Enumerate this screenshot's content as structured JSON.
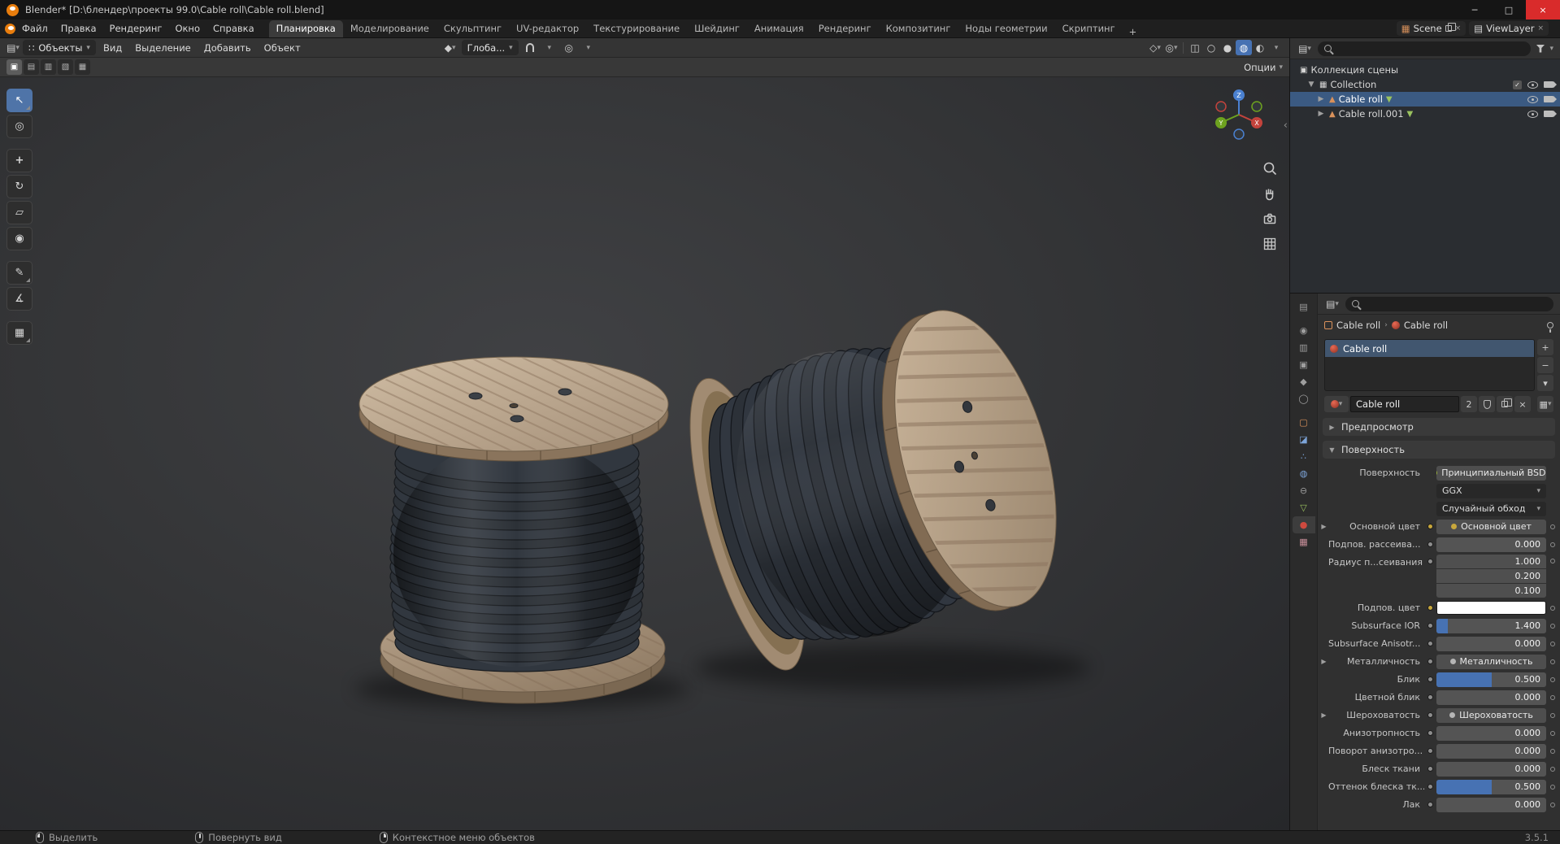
{
  "window": {
    "title": "Blender* [D:\\блендер\\проекты 99.0\\Cable roll\\Cable roll.blend]",
    "controls": {
      "minimize": "─",
      "maximize": "□",
      "close": "×"
    }
  },
  "topbar": {
    "menus": [
      "Файл",
      "Правка",
      "Рендеринг",
      "Окно",
      "Справка"
    ],
    "workspaces": [
      "Планировка",
      "Моделирование",
      "Скульптинг",
      "UV-редактор",
      "Текстурирование",
      "Шейдинг",
      "Анимация",
      "Рендеринг",
      "Композитинг",
      "Ноды геометрии",
      "Скриптинг"
    ],
    "active_workspace": "Планировка",
    "add_tab": "+",
    "scene": "Scene",
    "viewlayer": "ViewLayer"
  },
  "viewport": {
    "mode": "Объекты",
    "menus": [
      "Вид",
      "Выделение",
      "Добавить",
      "Объект"
    ],
    "orientation": "Глоба...",
    "tool_options": "Опции",
    "active_shading": "material-preview"
  },
  "outliner": {
    "rows": [
      {
        "label": "Коллекция сцены"
      },
      {
        "label": "Collection"
      },
      {
        "label": "Cable roll",
        "selected": true
      },
      {
        "label": "Cable roll.001"
      }
    ]
  },
  "properties": {
    "breadcrumb": {
      "object": "Cable roll",
      "separator": "›",
      "material": "Cable roll"
    },
    "slot": "Cable roll",
    "slot_buttons": {
      "add": "+",
      "remove": "−",
      "specials": "▾"
    },
    "datablock": {
      "name": "Cable roll",
      "users": "2"
    },
    "panels": {
      "preview": "Предпросмотр",
      "surface": "Поверхность"
    },
    "fields": [
      {
        "label": "Поверхность",
        "value": "Принципиальный BSDF"
      },
      {
        "label": "",
        "value": "GGX"
      },
      {
        "label": "",
        "value": "Случайный обход"
      },
      {
        "label": "Основной цвет",
        "value": "Основной цвет"
      },
      {
        "label": "Подпов. рассеива...",
        "value": "0.000",
        "fill": 0
      },
      {
        "label": "Радиус п...сеивания",
        "values": [
          "1.000",
          "0.200",
          "0.100"
        ]
      },
      {
        "label": "Подпов. цвет",
        "color": "#ffffff"
      },
      {
        "label": "Subsurface IOR",
        "value": "1.400",
        "fill": 0.1
      },
      {
        "label": "Subsurface Anisotr...",
        "value": "0.000",
        "fill": 0
      },
      {
        "label": "Металличность",
        "value": "Металличность"
      },
      {
        "label": "Блик",
        "value": "0.500",
        "fill": 0.5
      },
      {
        "label": "Цветной блик",
        "value": "0.000",
        "fill": 0
      },
      {
        "label": "Шероховатость",
        "value": "Шероховатость"
      },
      {
        "label": "Анизотропность",
        "value": "0.000",
        "fill": 0
      },
      {
        "label": "Поворот анизотро...",
        "value": "0.000",
        "fill": 0
      },
      {
        "label": "Блеск ткани",
        "value": "0.000",
        "fill": 0
      },
      {
        "label": "Оттенок блеска тк...",
        "value": "0.500",
        "fill": 0.5
      },
      {
        "label": "Лак",
        "value": "0.000",
        "fill": 0
      }
    ]
  },
  "statusbar": {
    "hints": [
      "Выделить",
      "Повернуть вид",
      "Контекстное меню объектов"
    ],
    "version": "3.5.1"
  },
  "colors": {
    "accent": "#4772b3",
    "selection": "#3b5a82",
    "wood": "#b7a28a",
    "cable": "#2e333a"
  }
}
